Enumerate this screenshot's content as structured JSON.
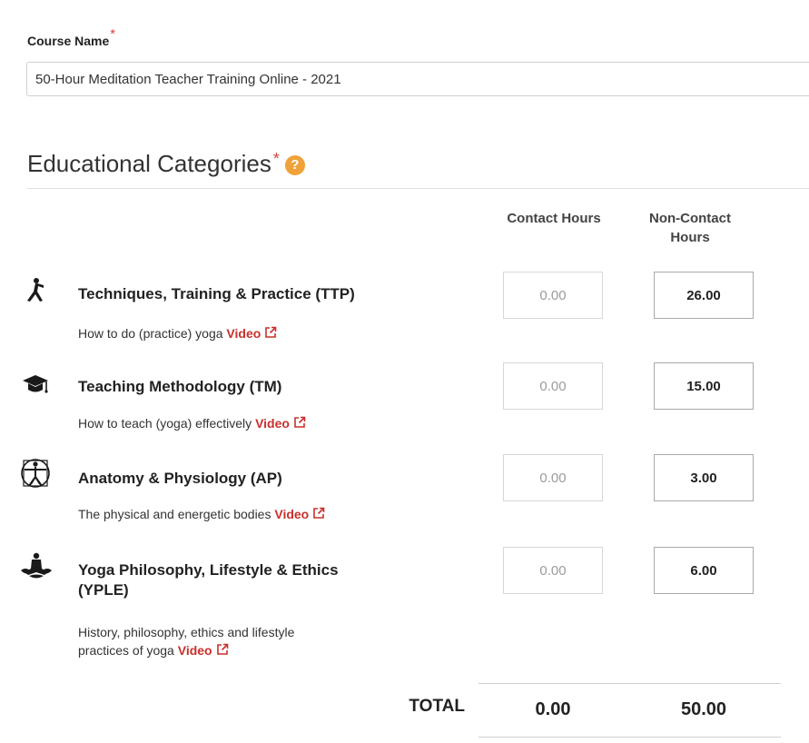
{
  "course": {
    "label": "Course Name",
    "required_mark": "*",
    "value": "50-Hour Meditation Teacher Training Online - 2021"
  },
  "section": {
    "title": "Educational Categories",
    "required_mark": "*",
    "help_glyph": "?"
  },
  "columns": {
    "contact": "Contact Hours",
    "noncontact_line1": "Non-Contact",
    "noncontact_line2": "Hours"
  },
  "categories": [
    {
      "icon": "yoga-pose-icon",
      "name": "Techniques, Training & Practice (TTP)",
      "description": "How to do (practice) yoga",
      "link": "Video",
      "contact_hours": "0.00",
      "noncontact_hours": "26.00"
    },
    {
      "icon": "graduation-cap-icon",
      "name": "Teaching Methodology (TM)",
      "description": "How to teach (yoga) effectively",
      "link": "Video",
      "contact_hours": "0.00",
      "noncontact_hours": "15.00"
    },
    {
      "icon": "vitruvian-man-icon",
      "name": "Anatomy & Physiology (AP)",
      "description": "The physical and energetic bodies",
      "link": "Video",
      "contact_hours": "0.00",
      "noncontact_hours": "3.00"
    },
    {
      "icon": "lotus-meditation-icon",
      "name_line1": "Yoga Philosophy, Lifestyle & Ethics",
      "name_line2": "(YPLE)",
      "description_line1": "History, philosophy, ethics and lifestyle",
      "description_line2": "practices of yoga",
      "link": "Video",
      "contact_hours": "0.00",
      "noncontact_hours": "6.00"
    }
  ],
  "total": {
    "label": "TOTAL",
    "contact": "0.00",
    "noncontact": "50.00"
  },
  "colors": {
    "accent_red": "#c9302c",
    "required_star": "#d64545",
    "help_orange": "#f0a23a"
  }
}
